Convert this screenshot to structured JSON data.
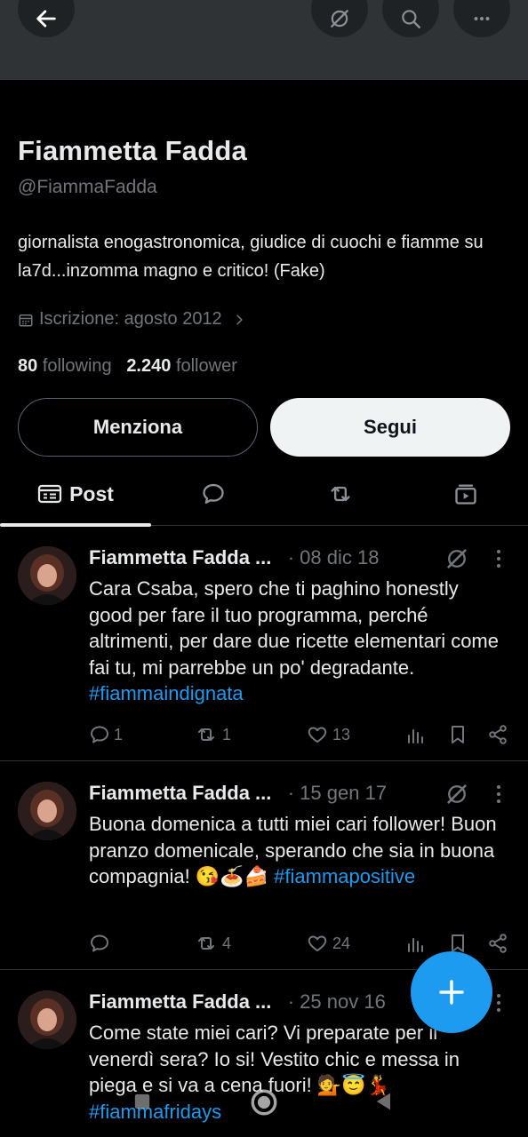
{
  "profile": {
    "name": "Fiammetta Fadda",
    "handle": "@FiammaFadda",
    "bio": "giornalista enogastronomica, giudice di cuochi e fiamme su la7d...inzomma magno e critico! (Fake)",
    "joined": "Iscrizione: agosto 2012",
    "following_count": "80",
    "following_label": "following",
    "followers_count": "2.240",
    "followers_label": "follower"
  },
  "buttons": {
    "mention": "Menziona",
    "follow": "Segui"
  },
  "tabs": {
    "post": "Post"
  },
  "tweets": [
    {
      "name": "Fiammetta Fadda ...",
      "date": "· 08 dic 18",
      "text": "Cara Csaba, spero che ti paghino honestly good per fare il tuo programma, perché altrimenti, per dare due ricette elementari come fai tu, mi parrebbe un po' degradante. ",
      "hashtag": "#fiammaindignata",
      "replies": "1",
      "retweets": "1",
      "likes": "13"
    },
    {
      "name": "Fiammetta Fadda ...",
      "date": "· 15 gen 17",
      "text": "Buona domenica a tutti miei cari follower! Buon pranzo domenicale, sperando che sia in buona compagnia! 😘🍝🍰 ",
      "hashtag": "#fiammapositive",
      "replies": "",
      "retweets": "4",
      "likes": "24"
    },
    {
      "name": "Fiammetta Fadda ...",
      "date": "· 25 nov 16",
      "text": "Come state miei cari? Vi preparate per il venerdì sera? Io si! Vestito chic e messa in piega e si va a cena fuori! 💁😇💃 ",
      "hashtag": "#fiammafridays"
    }
  ],
  "icons": {
    "back": "arrow-left-icon",
    "grok": "grok-icon",
    "search": "search-icon",
    "more": "more-icon",
    "calendar": "calendar-icon",
    "compose": "plus-icon"
  },
  "colors": {
    "accent": "#1d9bf0",
    "background": "#000000",
    "muted": "#71767b"
  }
}
